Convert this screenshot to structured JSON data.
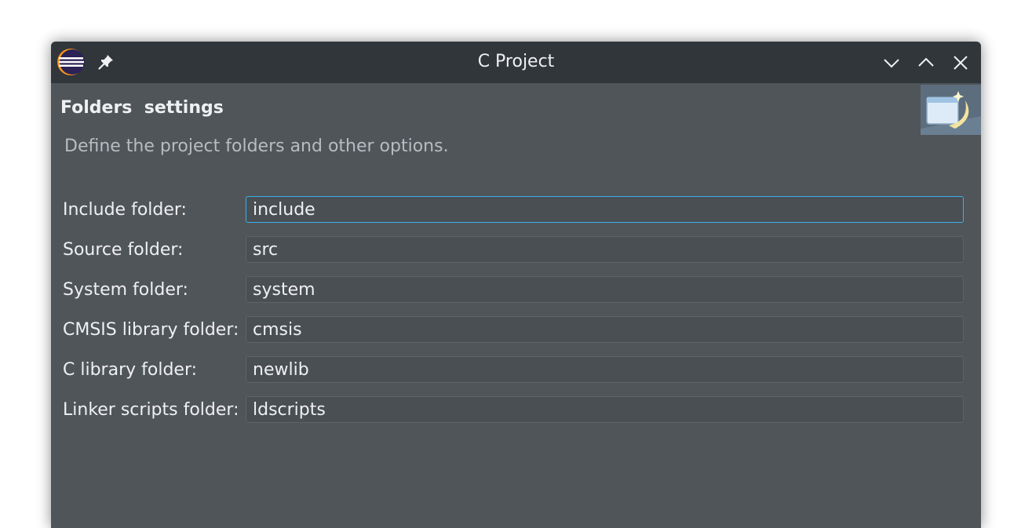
{
  "window": {
    "title": "C Project",
    "app_icon": "eclipse-icon",
    "pin_icon": "pin-icon",
    "controls": [
      "minimize-icon",
      "maximize-icon",
      "close-icon"
    ]
  },
  "header": {
    "title": "Folders  settings",
    "description": "Define the project folders and other options.",
    "banner_icon": "wizard-banner-icon"
  },
  "fields": [
    {
      "label": "Include folder:",
      "value": "include",
      "focused": true
    },
    {
      "label": "Source folder:",
      "value": "src"
    },
    {
      "label": "System folder:",
      "value": "system"
    },
    {
      "label": "CMSIS library folder:",
      "value": "cmsis"
    },
    {
      "label": "C library folder:",
      "value": "newlib"
    },
    {
      "label": "Linker scripts folder:",
      "value": "ldscripts"
    }
  ],
  "colors": {
    "titlebar": "#31363b",
    "body": "#50555a",
    "field_bg": "#4a4f54",
    "focus_accent": "#3daee9",
    "text": "#eff0f1"
  }
}
